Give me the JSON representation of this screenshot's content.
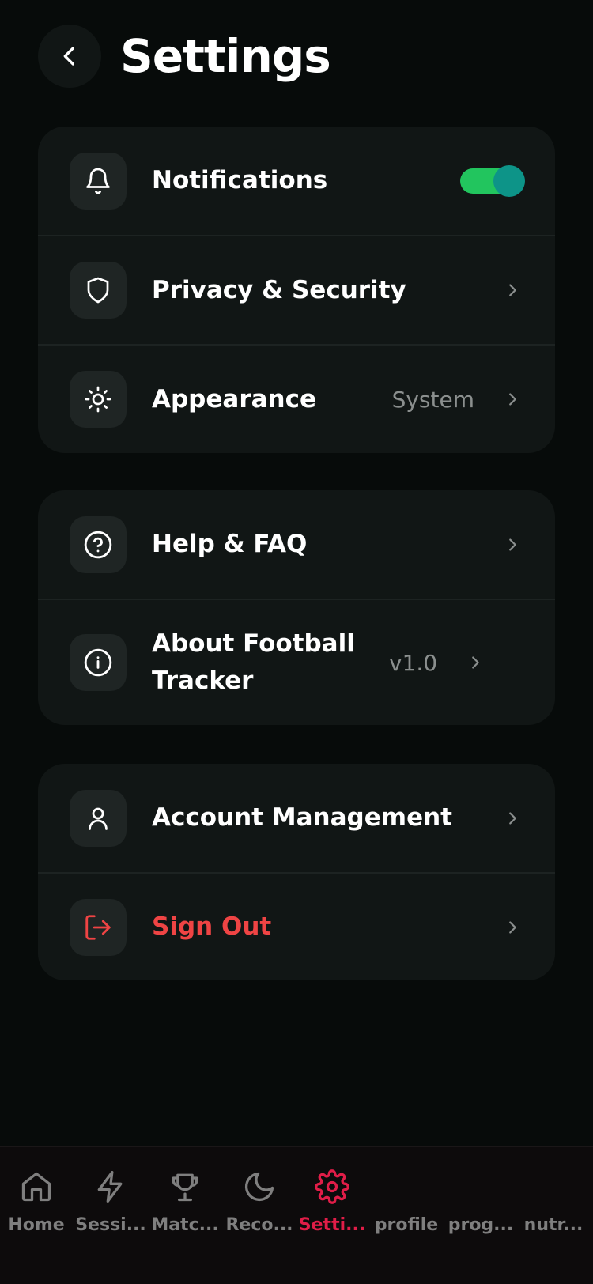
{
  "header": {
    "title": "Settings"
  },
  "groups": {
    "general": {
      "notifications": {
        "label": "Notifications",
        "enabled": true
      },
      "privacy": {
        "label": "Privacy & Security"
      },
      "appearance": {
        "label": "Appearance",
        "value": "System"
      }
    },
    "support": {
      "help": {
        "label": "Help & FAQ"
      },
      "about": {
        "label": "About Football Tracker",
        "value": "v1.0"
      }
    },
    "account": {
      "management": {
        "label": "Account Management"
      },
      "signout": {
        "label": "Sign Out"
      }
    }
  },
  "tabbar": {
    "tabs": [
      {
        "label": "Home",
        "icon": "home-icon"
      },
      {
        "label": "Sessi...",
        "icon": "bolt-icon"
      },
      {
        "label": "Matc...",
        "icon": "trophy-icon"
      },
      {
        "label": "Reco...",
        "icon": "moon-icon"
      },
      {
        "label": "Setti...",
        "icon": "gear-icon",
        "active": true
      },
      {
        "label": "profile"
      },
      {
        "label": "prog..."
      },
      {
        "label": "nutr..."
      }
    ]
  },
  "colors": {
    "background": "#070b0a",
    "card": "#111615",
    "toggle_track": "#22c55e",
    "toggle_knob": "#0d9488",
    "danger": "#ef4444",
    "active_tab": "#e11d48",
    "inactive_tab": "#7f7f7f"
  }
}
